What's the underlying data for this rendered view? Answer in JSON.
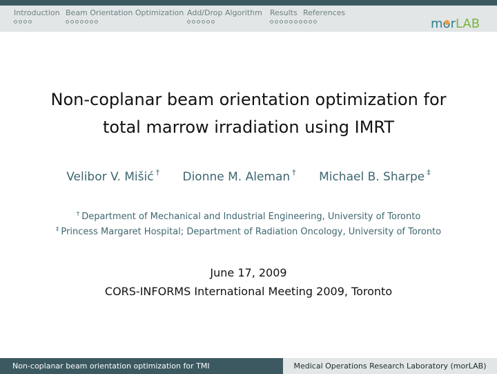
{
  "nav": {
    "sections": [
      {
        "label": "Introduction",
        "dots": 4
      },
      {
        "label": "Beam Orientation Optimization",
        "dots": 7
      },
      {
        "label": "Add/Drop Algorithm",
        "dots": 6
      },
      {
        "label": "Results",
        "dots": 10
      },
      {
        "label": "References",
        "dots": 0
      }
    ]
  },
  "logo": {
    "text_m": "m",
    "text_o": "o",
    "text_r": "r",
    "text_lab": "LAB",
    "colors": {
      "teal": "#2d7d8a",
      "orange": "#f29a3a",
      "green": "#7cb342"
    }
  },
  "slide": {
    "title_line1": "Non-coplanar beam orientation optimization for",
    "title_line2": "total marrow irradiation using IMRT",
    "authors": [
      {
        "name": "Velibor V. Mišić",
        "mark": "†"
      },
      {
        "name": "Dionne M. Aleman",
        "mark": "†"
      },
      {
        "name": "Michael B. Sharpe",
        "mark": "‡"
      }
    ],
    "affiliations": [
      {
        "mark": "†",
        "text": "Department of Mechanical and Industrial Engineering, University of Toronto"
      },
      {
        "mark": "‡",
        "text": "Princess Margaret Hospital; Department of Radiation Oncology, University of Toronto"
      }
    ],
    "date": "June 17, 2009",
    "meeting": "CORS-INFORMS International Meeting 2009, Toronto"
  },
  "footer": {
    "left": "Non-coplanar beam orientation optimization for TMI",
    "right": "Medical Operations Research Laboratory (morLAB)"
  },
  "colors": {
    "header_dark": "#3c5961",
    "header_light": "#e2e6e6",
    "author_text": "#3d6670"
  }
}
